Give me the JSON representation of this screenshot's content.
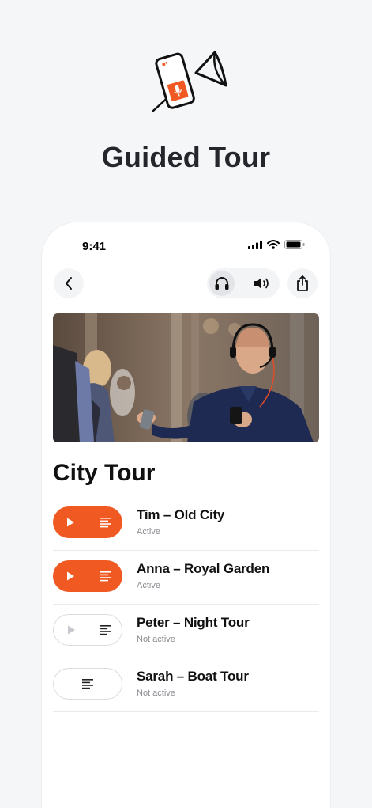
{
  "hero": {
    "title": "Guided Tour",
    "icon": "phone-megaphone-icon"
  },
  "status_bar": {
    "time": "9:41"
  },
  "toolbar": {
    "back_icon": "chevron-left-icon",
    "headphones_icon": "headphones-icon",
    "speaker_icon": "speaker-icon",
    "share_icon": "share-icon"
  },
  "section": {
    "title": "City Tour"
  },
  "tours": [
    {
      "name": "Tim – Old City",
      "status": "Active",
      "state": "active",
      "has_play": true
    },
    {
      "name": "Anna – Royal Garden",
      "status": "Active",
      "state": "active",
      "has_play": true
    },
    {
      "name": "Peter – Night Tour",
      "status": "Not active",
      "state": "inactive",
      "has_play": true
    },
    {
      "name": "Sarah – Boat Tour",
      "status": "Not active",
      "state": "inactive",
      "has_play": false
    }
  ],
  "colors": {
    "accent": "#f05a22",
    "background": "#f5f6f8",
    "card": "#ffffff"
  }
}
